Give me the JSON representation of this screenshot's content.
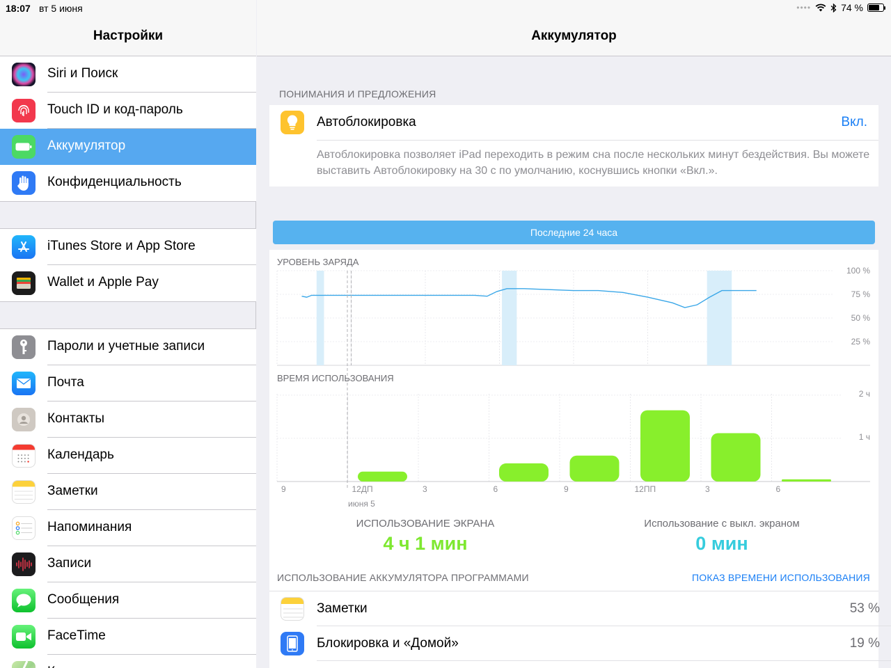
{
  "status": {
    "time": "18:07",
    "date": "вт 5 июня",
    "battery_percent": "74 %",
    "battery_level": 0.74
  },
  "sidebar": {
    "title": "Настройки",
    "group1": [
      {
        "label": "Siri и Поиск",
        "icon": "siri-icon",
        "color": "#1f1f3a"
      },
      {
        "label": "Touch ID и код-пароль",
        "icon": "fingerprint-icon",
        "color": "#f2384d"
      },
      {
        "label": "Аккумулятор",
        "icon": "battery-icon",
        "color": "#4cd964",
        "selected": true
      },
      {
        "label": "Конфиденциальность",
        "icon": "hand-icon",
        "color": "#2f7af5"
      }
    ],
    "group2": [
      {
        "label": "iTunes Store и App Store",
        "icon": "app-store-icon",
        "color": "#1e8cf7"
      },
      {
        "label": "Wallet и Apple Pay",
        "icon": "wallet-icon",
        "color": "#1c1c1c"
      }
    ],
    "group3": [
      {
        "label": "Пароли и учетные записи",
        "icon": "key-icon",
        "color": "#8e8e93"
      },
      {
        "label": "Почта",
        "icon": "mail-icon",
        "color": "#2b8ff7"
      },
      {
        "label": "Контакты",
        "icon": "contacts-icon",
        "color": "#c8c3bd"
      },
      {
        "label": "Календарь",
        "icon": "calendar-icon",
        "color": "#ffffff"
      },
      {
        "label": "Заметки",
        "icon": "notes-icon",
        "color": "#ffffff"
      },
      {
        "label": "Напоминания",
        "icon": "reminders-icon",
        "color": "#ffffff"
      },
      {
        "label": "Записи",
        "icon": "voice-memos-icon",
        "color": "#1c1c1e"
      },
      {
        "label": "Сообщения",
        "icon": "messages-icon",
        "color": "#4cd964"
      },
      {
        "label": "FaceTime",
        "icon": "facetime-icon",
        "color": "#4cd964"
      },
      {
        "label": "К",
        "icon": "maps-icon",
        "color": "#5fc35a"
      }
    ]
  },
  "main": {
    "title": "Аккумулятор",
    "insights": {
      "caption": "ПОНИМАНИЯ И ПРЕДЛОЖЕНИЯ",
      "title": "Автоблокировка",
      "action": "Вкл.",
      "description": "Автоблокировка позволяет iPad переходить в режим сна после нескольких минут бездействия. Вы можете выставить Автоблокировку на 30 с по умолчанию, коснувшись кнопки «Вкл.»."
    },
    "segment_label": "Последние 24 часа",
    "stats": {
      "screen_on_label": "ИСПОЛЬЗОВАНИЕ ЭКРАНА",
      "screen_on_value": "4 ч 1 мин",
      "screen_off_label": "Использование с выкл. экраном",
      "screen_off_value": "0 мин"
    },
    "apps_caption": "ИСПОЛЬЗОВАНИЕ АККУМУЛЯТОРА ПРОГРАММАМИ",
    "apps_link": "ПОКАЗ ВРЕМЕНИ ИСПОЛЬЗОВАНИЯ",
    "apps": [
      {
        "label": "Заметки",
        "percent": "53 %",
        "icon": "notes-icon"
      },
      {
        "label": "Блокировка и «Домой»",
        "percent": "19 %",
        "icon": "home-lock-icon"
      }
    ]
  },
  "chart_data": [
    {
      "type": "line",
      "title": "УРОВЕНЬ ЗАРЯДА",
      "y_ticks": [
        "100 %",
        "75 %",
        "50 %",
        "25 %"
      ],
      "ylim": [
        0,
        100
      ],
      "x_hours": [
        0,
        1,
        2,
        3,
        4,
        5,
        6,
        7,
        8,
        9,
        10,
        11,
        12,
        13,
        14,
        15,
        16,
        17,
        18,
        19,
        20,
        21,
        22,
        23,
        24
      ],
      "points": [
        [
          1,
          73
        ],
        [
          1.2,
          72
        ],
        [
          1.4,
          74
        ],
        [
          2,
          74
        ],
        [
          3,
          74
        ],
        [
          4,
          74
        ],
        [
          5,
          74
        ],
        [
          6,
          74
        ],
        [
          7,
          74
        ],
        [
          8,
          74
        ],
        [
          8.5,
          73
        ],
        [
          8.9,
          78
        ],
        [
          9.3,
          81
        ],
        [
          10,
          81
        ],
        [
          11,
          80
        ],
        [
          12,
          79
        ],
        [
          13,
          79
        ],
        [
          14,
          77
        ],
        [
          15,
          72
        ],
        [
          16,
          66
        ],
        [
          16.5,
          61
        ],
        [
          17,
          64
        ],
        [
          17.5,
          72
        ],
        [
          18,
          79
        ],
        [
          19,
          79
        ],
        [
          19.4,
          79
        ]
      ],
      "charging_ranges": [
        [
          1.6,
          1.9
        ],
        [
          9.1,
          9.7
        ],
        [
          17.4,
          18.4
        ]
      ],
      "grid": true
    },
    {
      "type": "bar",
      "title": "ВРЕМЯ ИСПОЛЬЗОВАНИЯ",
      "y_ticks": [
        "2 ч",
        "1 ч"
      ],
      "ylim": [
        0,
        2
      ],
      "categories": [
        "12ДП",
        "3",
        "6",
        "9",
        "12ПП",
        "3",
        "6",
        "9"
      ],
      "x_tick_labels": [
        "9",
        "12ДП",
        "3",
        "6",
        "9",
        "12ПП",
        "3",
        "6"
      ],
      "x_sublabel": "июня 5",
      "values": [
        0.23,
        0,
        0.42,
        0.6,
        1.65,
        1.12,
        0.05,
        0
      ],
      "grid": true
    }
  ]
}
